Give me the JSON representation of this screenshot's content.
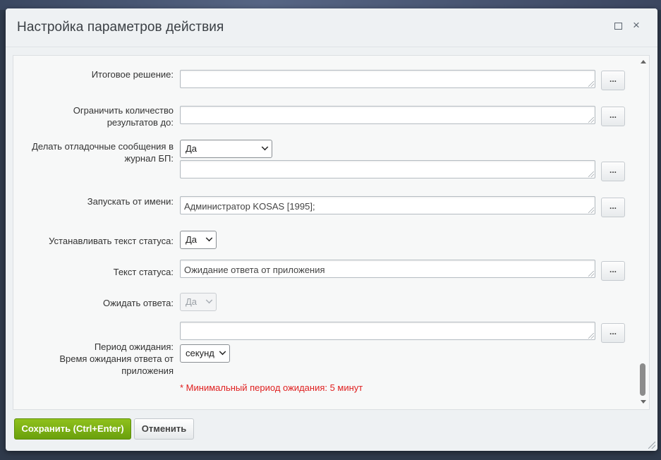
{
  "dialog": {
    "title": "Настройка параметров действия",
    "maximize_icon": "maximize-icon",
    "close_icon": "×"
  },
  "fields": {
    "final_decision": {
      "label": "Итоговое решение:",
      "value": "",
      "dots": "..."
    },
    "limit_results": {
      "label": "Ограничить количество результатов до:",
      "value": "",
      "dots": "..."
    },
    "debug_messages": {
      "label": "Делать отладочные сообщения в журнал БП:",
      "select": "Да",
      "value": "",
      "dots": "..."
    },
    "run_as": {
      "label": "Запускать от имени:",
      "value": "Администратор KOSAS [1995];",
      "dots": "..."
    },
    "set_status": {
      "label": "Устанавливать текст статуса:",
      "select": "Да"
    },
    "status_text": {
      "label": "Текст статуса:",
      "value": "Ожидание ответа от приложения",
      "dots": "..."
    },
    "wait_answer": {
      "label": "Ожидать ответа:",
      "select": "Да"
    },
    "wait_period": {
      "label": "Период ожидания:",
      "label2": "Время ожидания ответа от приложения",
      "value": "",
      "unit": "секунд",
      "dots": "...",
      "hint": "* Минимальный период ожидания: 5 минут"
    }
  },
  "footer": {
    "save_label": "Сохранить (Ctrl+Enter)",
    "cancel_label": "Отменить"
  },
  "colors": {
    "save_button": "#7ab317",
    "hint": "#e02020"
  }
}
